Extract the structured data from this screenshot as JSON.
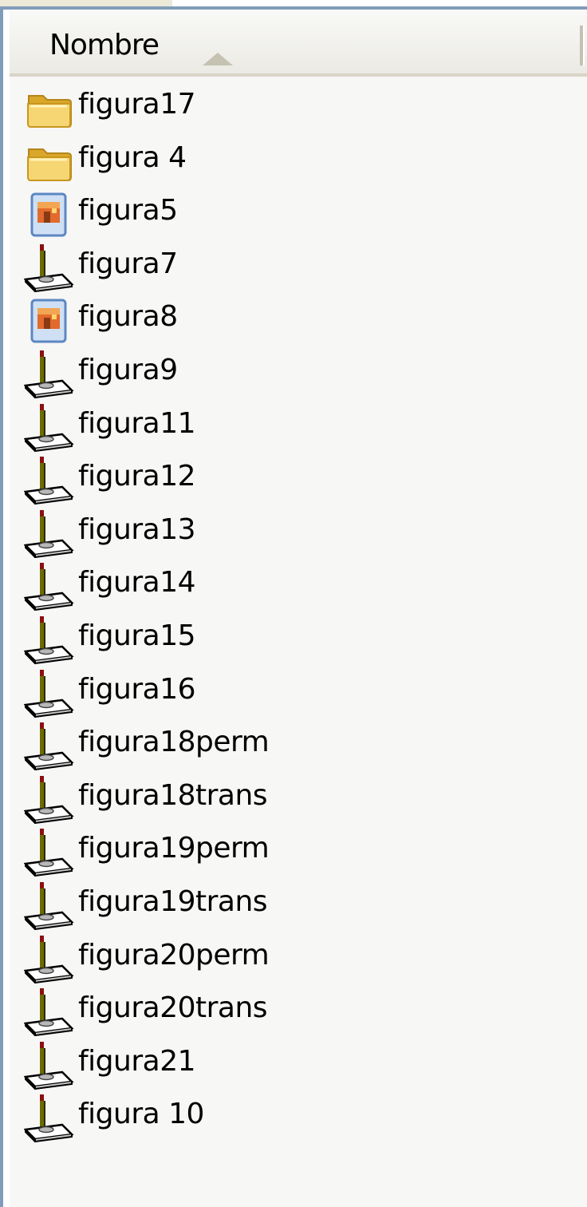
{
  "header": {
    "name_label": "Nombre"
  },
  "files": [
    {
      "name": "figura17",
      "icon": "folder-icon"
    },
    {
      "name": "figura 4",
      "icon": "folder-icon"
    },
    {
      "name": "figura5",
      "icon": "image-file-icon"
    },
    {
      "name": "figura7",
      "icon": "joystick-icon"
    },
    {
      "name": "figura8",
      "icon": "image-file-icon"
    },
    {
      "name": "figura9",
      "icon": "joystick-icon"
    },
    {
      "name": "figura11",
      "icon": "joystick-icon"
    },
    {
      "name": "figura12",
      "icon": "joystick-icon"
    },
    {
      "name": "figura13",
      "icon": "joystick-icon"
    },
    {
      "name": "figura14",
      "icon": "joystick-icon"
    },
    {
      "name": "figura15",
      "icon": "joystick-icon"
    },
    {
      "name": "figura16",
      "icon": "joystick-icon"
    },
    {
      "name": "figura18perm",
      "icon": "joystick-icon"
    },
    {
      "name": "figura18trans",
      "icon": "joystick-icon"
    },
    {
      "name": "figura19perm",
      "icon": "joystick-icon"
    },
    {
      "name": "figura19trans",
      "icon": "joystick-icon"
    },
    {
      "name": "figura20perm",
      "icon": "joystick-icon"
    },
    {
      "name": "figura20trans",
      "icon": "joystick-icon"
    },
    {
      "name": "figura21",
      "icon": "joystick-icon"
    },
    {
      "name": "figura 10",
      "icon": "joystick-icon"
    }
  ],
  "colors": {
    "frame": "#7f9db9",
    "background": "#f7f7f6",
    "folder": "#f0c654"
  }
}
